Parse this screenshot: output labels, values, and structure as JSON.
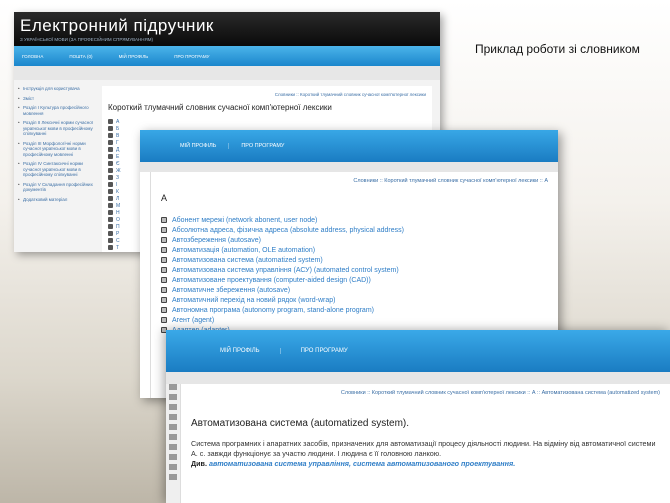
{
  "caption": "Приклад роботи зі словником",
  "window1": {
    "title": "Електронний підручник",
    "subtitle": "з української мови (за професійним спрямуванням)",
    "nav": [
      "Головна",
      "Пошта (0)",
      "Мій профіль",
      "Про програму"
    ],
    "sidebar": [
      "Інструкція для користувача",
      "Зміст",
      "Розділ I Культура професійного мовлення",
      "Розділ II Лексичні норми сучасної української мови в професійному спілкуванні",
      "Розділ III Морфологічні норми сучасної української мови в професійному мовленні",
      "Розділ IV Синтаксичні норми сучасної української мови в професійному спілкуванні",
      "Розділ V Складання професійних документів",
      "Додатковий матеріал"
    ],
    "breadcrumb": "Словники :: Короткий тлумачний словник сучасної комп'ютерної лексики",
    "heading": "Короткий тлумачний словник сучасної комп'ютерної лексики",
    "letters": [
      "А",
      "Б",
      "В",
      "Г",
      "Д",
      "Е",
      "Є",
      "Ж",
      "З",
      "І",
      "К",
      "Л",
      "М",
      "Н",
      "О",
      "П",
      "Р",
      "С",
      "Т"
    ]
  },
  "window2": {
    "nav": [
      "Мій профіль",
      "Про програму"
    ],
    "breadcrumb_link": "Словники :: Короткий тлумачний словник сучасної комп'ютерної лексики :: А",
    "letter": "А",
    "entries": [
      "Абонент мережі (network abonent, user node)",
      "Абсолютна адреса, фізична адреса (absolute address, physical address)",
      "Автозбереження (autosave)",
      "Автоматизація (automation, OLE automation)",
      "Автоматизована система (automatized system)",
      "Автоматизована система управління (АСУ) (automated control system)",
      "Автоматизоване проектування (computer-aided design (CAD))",
      "Автоматичне збереження (autosave)",
      "Автоматичний перехід на новий рядок (word-wrap)",
      "Автономна програма (autonomy program, stand-alone program)",
      "Агент (agent)",
      "Адаптер (adapter)"
    ]
  },
  "window3": {
    "nav": [
      "Мій профіль",
      "Про програму"
    ],
    "breadcrumb": "Словники :: Короткий тлумачний словник сучасної комп'ютерної лексики :: А :: Автоматизована система (automatized system)",
    "term": "Автоматизована система (automatized system).",
    "definition": "Система програмних і апаратних засобів, призначених для автоматизації процесу діяльності людини. На відміну від автоматичної системи А. с. завжди функціонує за участю людини. І людина є її головною ланкою.",
    "see_label": "Див.",
    "see_links": "автоматизована система управління, система автоматизованого проектування."
  }
}
